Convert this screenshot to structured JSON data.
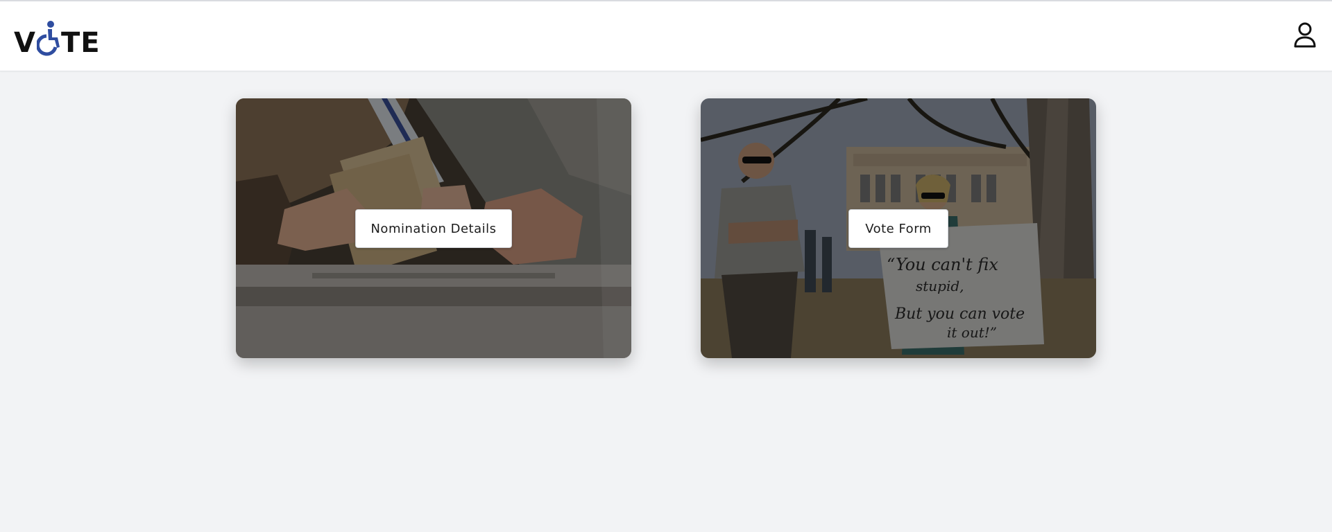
{
  "app": {
    "logo": {
      "prefix": "V",
      "suffix": "TE",
      "accent_color": "#2f4da0"
    },
    "icons": {
      "logo_mark": "wheelchair-accessibility-icon",
      "account": "user-icon"
    }
  },
  "cards": [
    {
      "label": "Nomination Details",
      "image": "ballot-box-photo"
    },
    {
      "label": "Vote Form",
      "image": "protest-sign-photo",
      "sign_text": {
        "line1": "“You can't fix",
        "line2": "stupid,",
        "line3": "But you can vote",
        "line4": "it out!”"
      }
    }
  ]
}
